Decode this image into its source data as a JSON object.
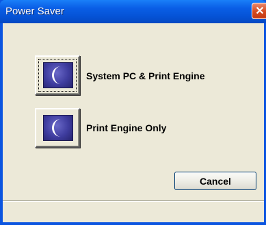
{
  "window": {
    "title": "Power Saver",
    "close_glyph": "✕"
  },
  "options": [
    {
      "label": "System PC & Print Engine",
      "icon": "moon-icon",
      "focused": true
    },
    {
      "label": "Print Engine Only",
      "icon": "moon-icon",
      "focused": false
    }
  ],
  "footer": {
    "cancel_label": "Cancel"
  },
  "colors": {
    "titlebar": "#0553d6",
    "client_bg": "#ece9d8",
    "icon_bg": "#3e3c9e",
    "close_button": "#d4491f"
  }
}
